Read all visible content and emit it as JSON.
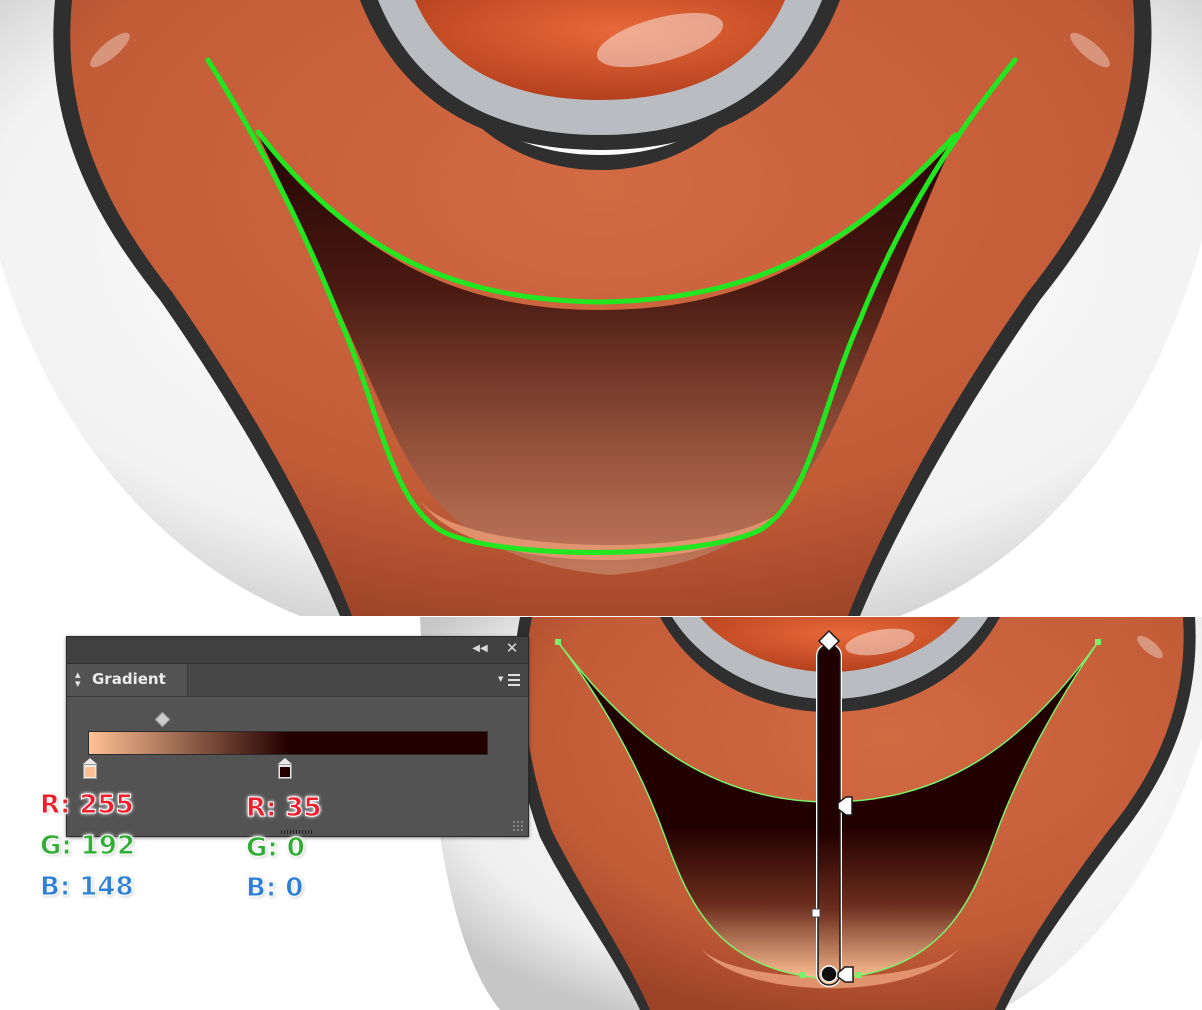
{
  "gradient_panel": {
    "tab_title": "Gradient",
    "collapse_icon": "double-chevron-left-icon",
    "close_icon": "close-icon",
    "menu_icon": "panel-menu-icon",
    "stops": [
      {
        "color": "#ffc094",
        "r_label": "R: 255",
        "g_label": "G: 192",
        "b_label": "B: 148"
      },
      {
        "color": "#230000",
        "r_label": "R: 35",
        "g_label": "G: 0",
        "b_label": "B: 0"
      }
    ]
  },
  "label_colors": {
    "r": "#f01e2d",
    "g": "#2eae32",
    "b": "#2d7fd8"
  },
  "colors": {
    "lip_orange": "#c05a38",
    "mouth_dark": "#230000",
    "mouth_light": "#ffc094",
    "path_highlight": "#22e61f",
    "panel_bg": "#535353"
  }
}
